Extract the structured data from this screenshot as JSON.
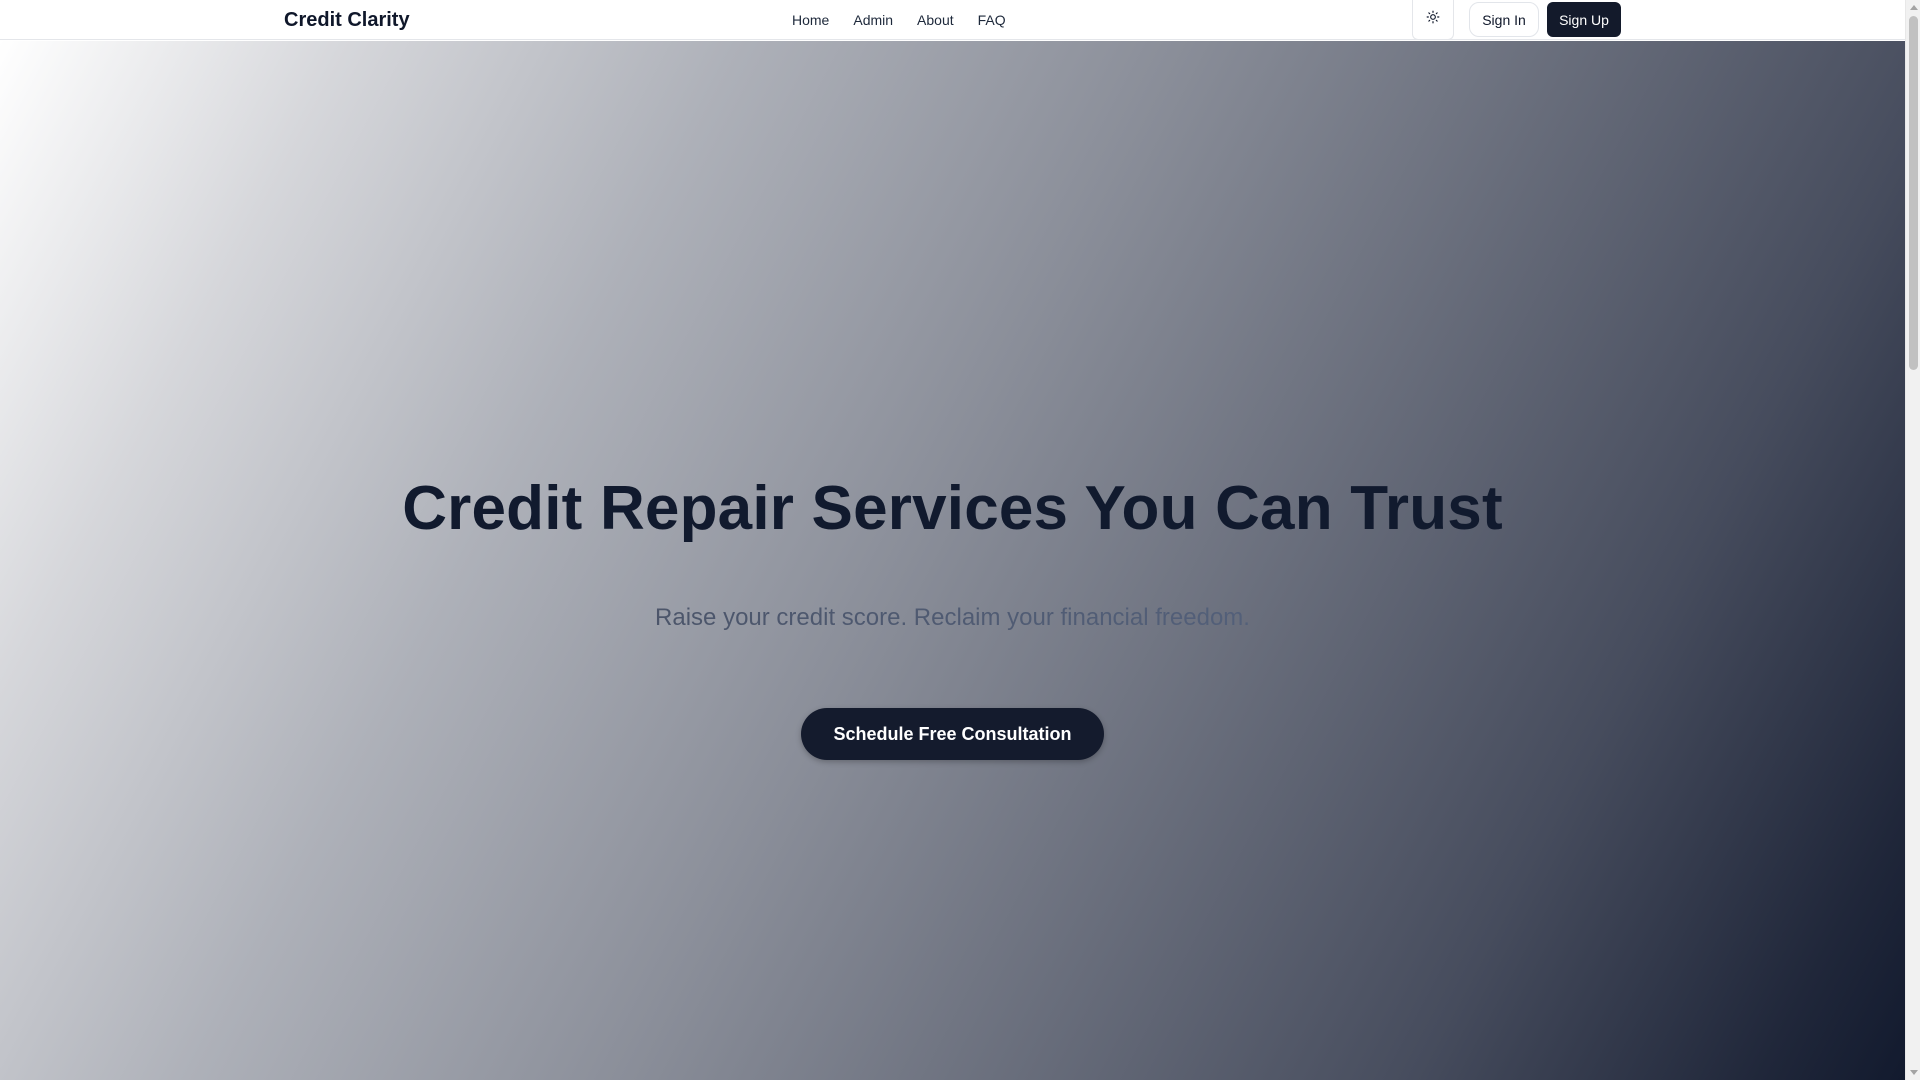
{
  "header": {
    "brand": "Credit Clarity",
    "nav": [
      {
        "label": "Home"
      },
      {
        "label": "Admin"
      },
      {
        "label": "About"
      },
      {
        "label": "FAQ"
      }
    ],
    "theme_toggle_icon": "sun-icon",
    "signin_label": "Sign In",
    "signup_label": "Sign Up"
  },
  "hero": {
    "title": "Credit Repair Services You Can Trust",
    "subtitle": "Raise your credit score. Reclaim your financial freedom.",
    "cta_label": "Schedule Free Consultation"
  },
  "colors": {
    "primary_dark": "#131a2b",
    "text_dark": "#0f172a",
    "gradient_start": "#ffffff",
    "gradient_end": "#121a2e"
  }
}
